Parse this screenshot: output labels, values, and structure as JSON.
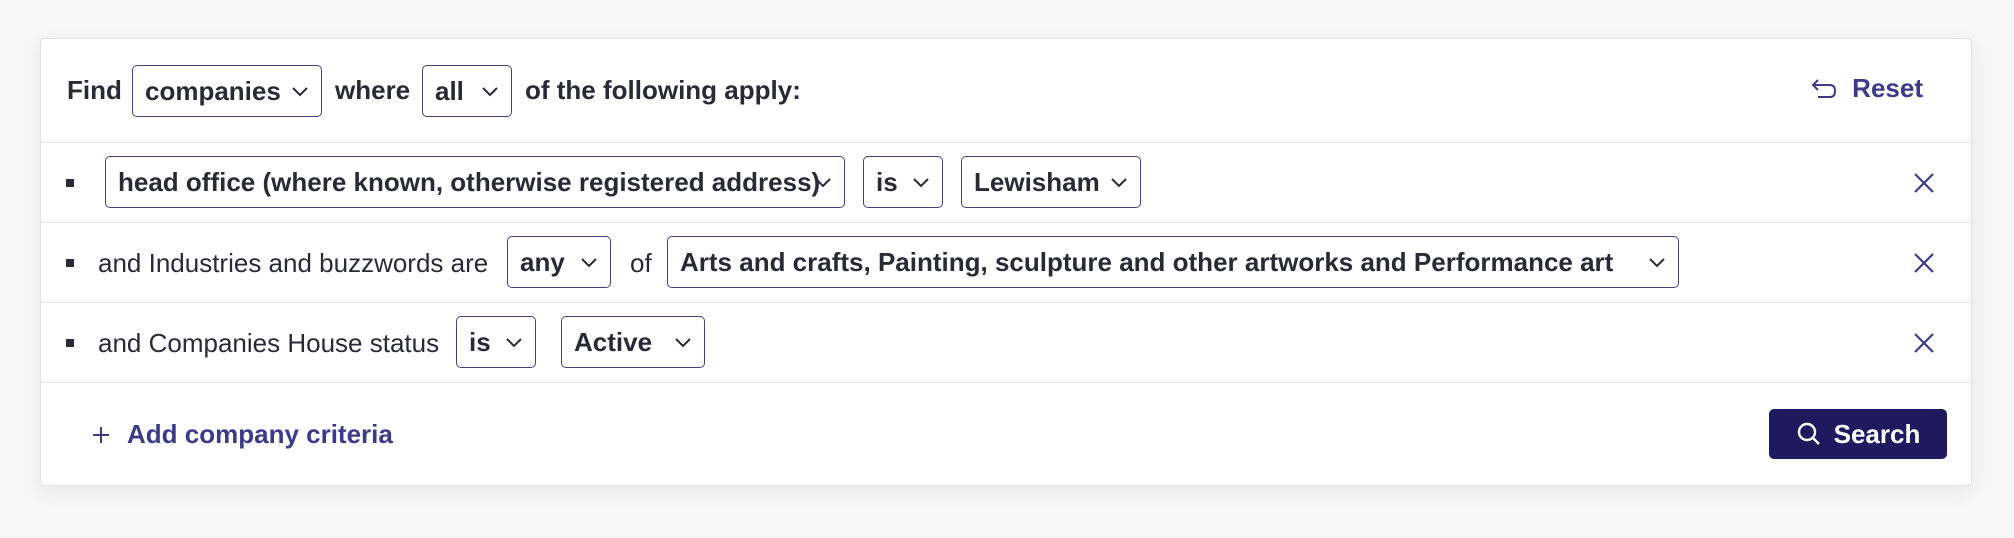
{
  "header": {
    "find_label": "Find",
    "entity_select": "companies",
    "where_label": "where",
    "match_select": "all",
    "suffix_label": "of the following apply:",
    "reset_label": "Reset"
  },
  "rules": [
    {
      "field_select": "head office (where known, otherwise registered address)",
      "operator_select": "is",
      "value_select": "Lewisham"
    },
    {
      "prefix": "and Industries and buzzwords are",
      "operator_select": "any",
      "of_label": "of",
      "value_select": "Arts and crafts, Painting, sculpture and other artworks and Performance art"
    },
    {
      "prefix": "and Companies House status",
      "operator_select": "is",
      "value_select": "Active"
    }
  ],
  "footer": {
    "add_label": "Add company criteria",
    "search_label": "Search"
  },
  "colors": {
    "accent": "#3e3a86",
    "button_bg": "#1f1a5e",
    "border": "#45407a"
  },
  "icons": [
    "chevron-down-icon",
    "reset-icon",
    "close-icon",
    "plus-icon",
    "search-icon"
  ]
}
